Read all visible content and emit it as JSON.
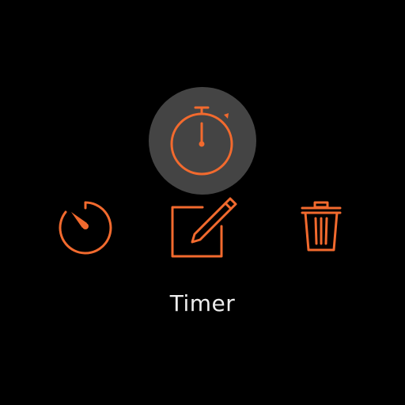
{
  "app": {
    "selected_label": "Timer"
  },
  "icons": {
    "stopwatch": "stopwatch-icon",
    "timer": "timer-icon",
    "edit": "edit-icon",
    "delete": "trash-icon"
  },
  "colors": {
    "accent": "#f26a2e",
    "background": "#000000",
    "selection_circle": "#444444",
    "label_text": "#eeeeee"
  }
}
